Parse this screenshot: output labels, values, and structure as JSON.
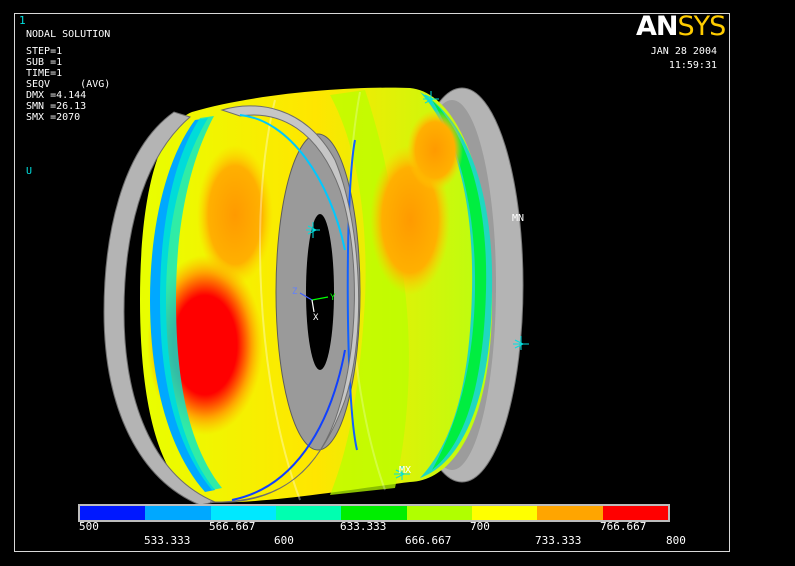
{
  "window_number": "1",
  "solution_title": "NODAL SOLUTION",
  "solution_info": [
    "STEP=1",
    "SUB =1",
    "TIME=1",
    "SEQV     (AVG)",
    "DMX =4.144",
    "SMN =26.13",
    "SMX =2070"
  ],
  "display_code": "U",
  "logo": {
    "left": "AN",
    "right": "SYS"
  },
  "date": "JAN 28 2004",
  "time": "11:59:31",
  "min_label": "MN",
  "max_label": "MX",
  "triad": {
    "z": "Z",
    "y": "Y",
    "x": "X"
  },
  "legend": {
    "colors": [
      "#0018ff",
      "#00a8ff",
      "#00e8ff",
      "#00ffb0",
      "#00ee00",
      "#b0ff00",
      "#ffff00",
      "#ffa500",
      "#ff0000"
    ],
    "labels": [
      "500",
      "533.333",
      "566.667",
      "600",
      "633.333",
      "666.667",
      "700",
      "733.333",
      "766.667",
      "800"
    ]
  },
  "palette": {
    "background": "#000000",
    "ring": "#b4b4b4",
    "frame": "#d8d8d8",
    "accent": "#00e0e0"
  }
}
